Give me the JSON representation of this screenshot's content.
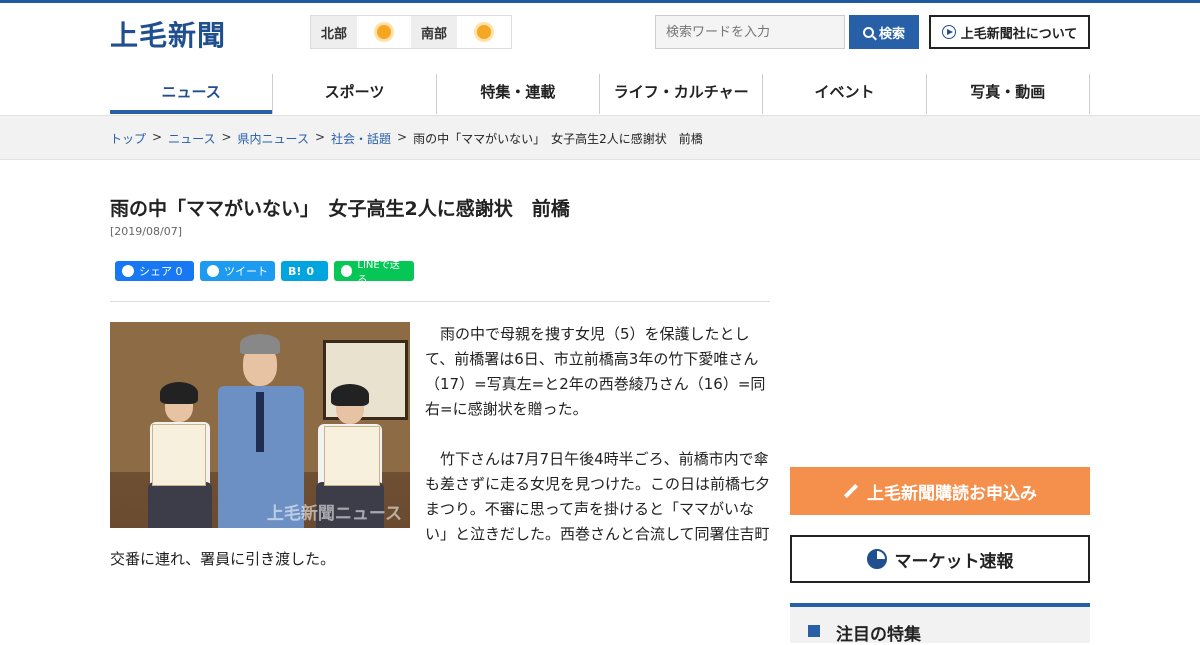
{
  "header": {
    "logo": "上毛新聞",
    "weather": [
      {
        "region": "北部",
        "icon": "sun-cloud-icon"
      },
      {
        "region": "南部",
        "icon": "sun-icon"
      }
    ],
    "search_placeholder": "検索ワードを入力",
    "search_button": "検索",
    "about_button": "上毛新聞社について"
  },
  "nav": [
    "ニュース",
    "スポーツ",
    "特集・連載",
    "ライフ・カルチャー",
    "イベント",
    "写真・動画"
  ],
  "breadcrumb": {
    "links": [
      "トップ",
      "ニュース",
      "県内ニュース",
      "社会・話題"
    ],
    "current": "雨の中「ママがいない」　女子高生2人に感謝状　前橋"
  },
  "article": {
    "title": "雨の中「ママがいない」　女子高生2人に感謝状　前橋",
    "date": "[2019/08/07]",
    "share": {
      "facebook": "シェア 0",
      "twitter": "ツイート",
      "hatena": "0",
      "line": "LINEで送る"
    },
    "photo_watermark": "上毛新聞ニュース",
    "paragraphs": [
      "　雨の中で母親を捜す女児（5）を保護したとして、前橋署は6日、市立前橋高3年の竹下愛唯さん（17）=写真左=と2年の西巻綾乃さん（16）=同右=に感謝状を贈った。",
      "　竹下さんは7月7日午後4時半ごろ、前橋市内で傘も差さずに走る女児を見つけた。この日は前橋七夕まつり。不審に思って声を掛けると「ママがいない」と泣きだした。西巻さんと合流して同署住吉町交番に連れ、署員に引き渡した。"
    ]
  },
  "sidebar": {
    "subscribe": "上毛新聞購読お申込み",
    "market": "マーケット速報",
    "feature": "注目の特集"
  },
  "colors": {
    "brand": "#1f4f8f",
    "accent": "#2860a8",
    "subscribe": "#f58f4c"
  }
}
